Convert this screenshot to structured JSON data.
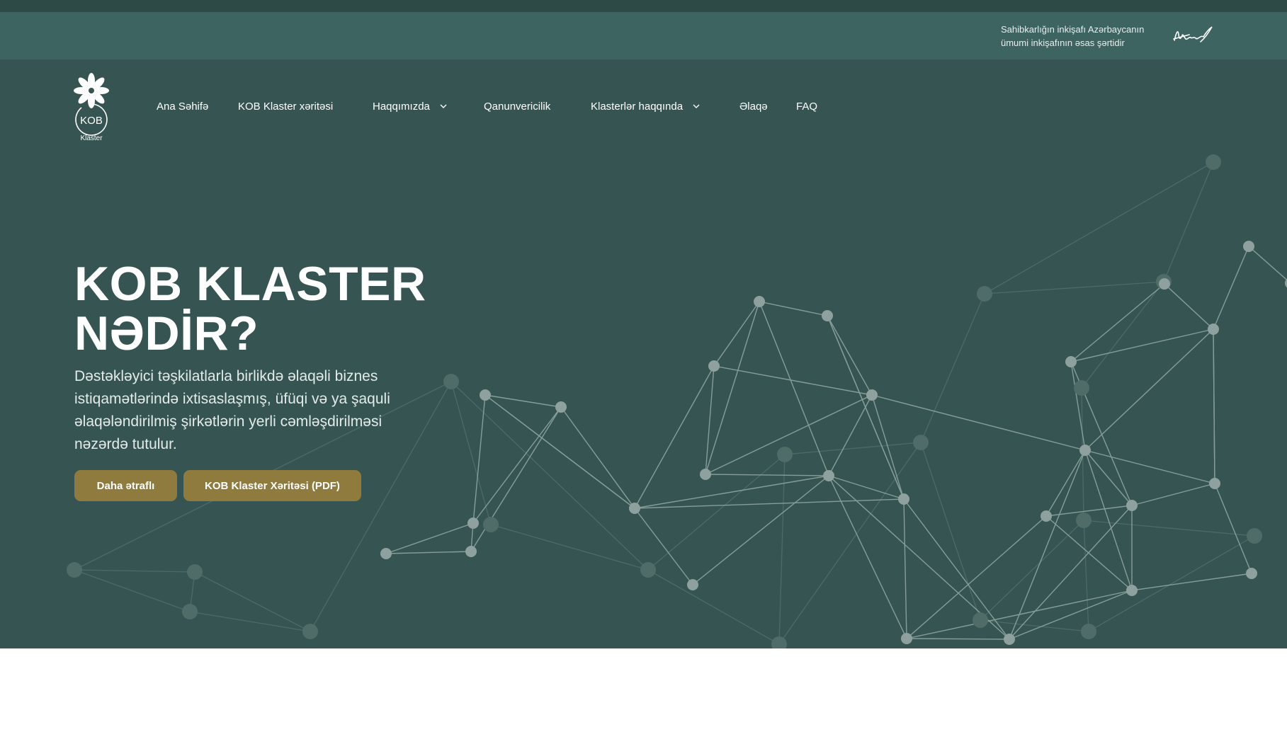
{
  "top_bar": {
    "slogan_line1": "Sahibkarlığın inkişafı Azərbaycanın",
    "slogan_line2": "ümumi inkişafının əsas şərtidir",
    "signature_icon": "signature-icon"
  },
  "logo": {
    "icon": "flower-logo-icon",
    "emblem_text": "KOB",
    "caption": "Klaster"
  },
  "nav": {
    "items": [
      {
        "label": "Ana Səhifə"
      },
      {
        "label": "KOB Klaster xəritəsi"
      },
      {
        "label": "Haqqımızda",
        "icon": "chevron-down-icon"
      },
      {
        "label": "Qanunvericilik"
      },
      {
        "label": "Klasterlər haqqında",
        "icon": "chevron-down-icon"
      },
      {
        "label": "Əlaqə"
      },
      {
        "label": "FAQ"
      }
    ]
  },
  "hero": {
    "title_line1": "KOB KLASTER",
    "title_line2": "NƏDİR?",
    "description": "Dəstəkləyici təşkilatlarla birlikdə əlaqəli biznes istiqamətlərində ixtisaslaşmış, üfüqi və ya şaquli əlaqələndirilmiş şirkətlərin yerli cəmləşdirilməsi nəzərdə tutulur.",
    "buttons": {
      "more_label": "Daha ətraflı",
      "pdf_label": "KOB Klaster Xəritəsi (PDF)"
    },
    "background_icon": "network-graph-icon"
  },
  "colors": {
    "hero_background": "#365552",
    "top_bar_background": "#3e6461",
    "button_gold": "#8e7b3d",
    "network_line": "#9fb3af"
  }
}
